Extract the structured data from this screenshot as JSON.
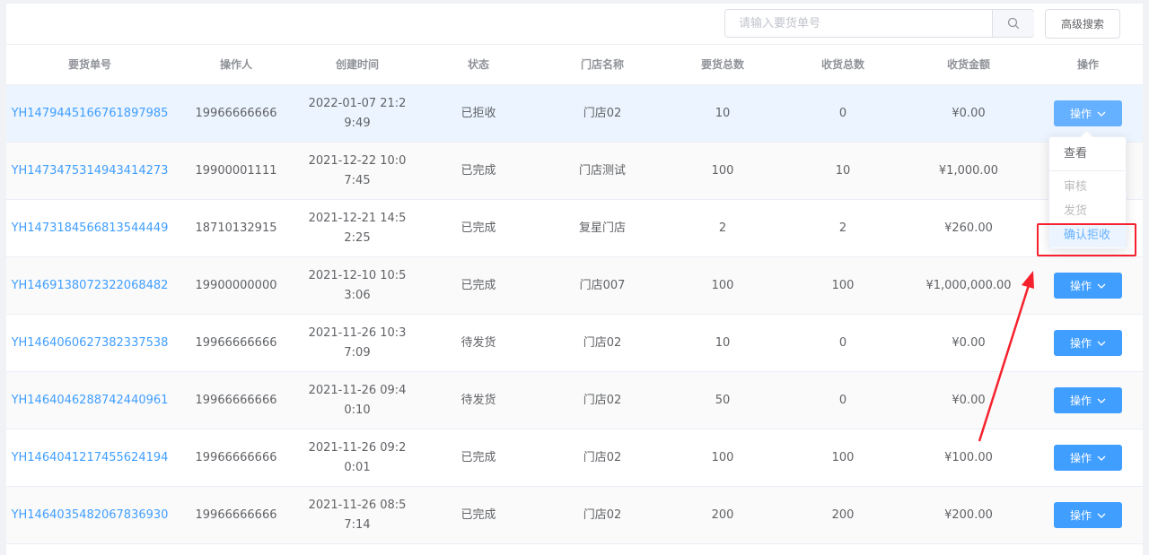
{
  "search": {
    "placeholder": "请输入要货单号"
  },
  "advanced_search_label": "高级搜索",
  "columns": [
    "要货单号",
    "操作人",
    "创建时间",
    "状态",
    "门店名称",
    "要货总数",
    "收货总数",
    "收货金额",
    "操作"
  ],
  "rows": [
    {
      "order_no": "YH1479445166761897985",
      "operator": "19966666666",
      "created": "2022-01-07 21:29:49",
      "status": "已拒收",
      "store": "门店02",
      "requested": "10",
      "received": "0",
      "amount": "¥0.00"
    },
    {
      "order_no": "YH1473475314943414273",
      "operator": "19900001111",
      "created": "2021-12-22 10:07:45",
      "status": "已完成",
      "store": "门店测试",
      "requested": "100",
      "received": "10",
      "amount": "¥1,000.00"
    },
    {
      "order_no": "YH1473184566813544449",
      "operator": "18710132915",
      "created": "2021-12-21 14:52:25",
      "status": "已完成",
      "store": "复星门店",
      "requested": "2",
      "received": "2",
      "amount": "¥260.00"
    },
    {
      "order_no": "YH1469138072322068482",
      "operator": "19900000000",
      "created": "2021-12-10 10:53:06",
      "status": "已完成",
      "store": "门店007",
      "requested": "100",
      "received": "100",
      "amount": "¥1,000,000.00"
    },
    {
      "order_no": "YH1464060627382337538",
      "operator": "19966666666",
      "created": "2021-11-26 10:37:09",
      "status": "待发货",
      "store": "门店02",
      "requested": "10",
      "received": "0",
      "amount": "¥0.00"
    },
    {
      "order_no": "YH1464046288742440961",
      "operator": "19966666666",
      "created": "2021-11-26 09:40:10",
      "status": "待发货",
      "store": "门店02",
      "requested": "50",
      "received": "0",
      "amount": "¥0.00"
    },
    {
      "order_no": "YH1464041217455624194",
      "operator": "19966666666",
      "created": "2021-11-26 09:20:01",
      "status": "已完成",
      "store": "门店02",
      "requested": "100",
      "received": "100",
      "amount": "¥100.00"
    },
    {
      "order_no": "YH1464035482067836930",
      "operator": "19966666666",
      "created": "2021-11-26 08:57:14",
      "status": "已完成",
      "store": "门店02",
      "requested": "200",
      "received": "200",
      "amount": "¥200.00"
    }
  ],
  "action_label": "操作",
  "dropdown": {
    "view": "查看",
    "review": "审核",
    "ship": "发货",
    "confirm_reject": "确认拒收"
  },
  "colors": {
    "primary": "#409eff",
    "highlight_box": "#f5222d",
    "arrow": "#f5222d"
  },
  "icons": {
    "search": "search-icon",
    "dropdown_arrow": "chevron-down-icon"
  }
}
